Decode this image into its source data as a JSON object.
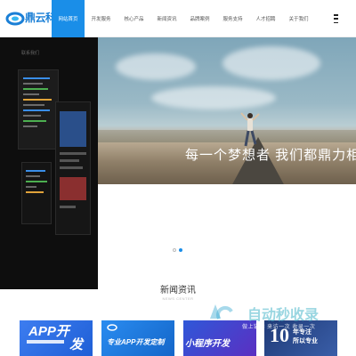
{
  "header": {
    "logo_text": "鼎云科技",
    "nav": [
      {
        "label": "网站首页",
        "active": true
      },
      {
        "label": "开发服务",
        "active": false
      },
      {
        "label": "核心产品",
        "active": false
      },
      {
        "label": "新闻资讯",
        "active": false
      },
      {
        "label": "品牌案例",
        "active": false
      },
      {
        "label": "服务支持",
        "active": false
      },
      {
        "label": "人才招聘",
        "active": false
      },
      {
        "label": "关于我们",
        "active": false
      }
    ],
    "menu_icon": "hamburger-menu-icon"
  },
  "dark_panel": {
    "label": "联系我们"
  },
  "hero": {
    "slogan": "每一个梦想者 我们都鼎力相"
  },
  "slider": {
    "total": 2,
    "current": 2
  },
  "news": {
    "title": "新闻资讯",
    "subtitle": "NEWS CENTER",
    "cards": [
      {
        "line1": "APP开",
        "line2": "发"
      },
      {
        "line1": "专业APP开发定制"
      },
      {
        "line1": "小程序开发"
      },
      {
        "line1": "10",
        "line2": "年专注",
        "line3": "所以专业"
      }
    ]
  },
  "watermark": {
    "text": "自动秒收录",
    "tagline": "做上链接 来访一次 收录一次"
  },
  "colors": {
    "accent": "#1a8ee8",
    "dark_panel": "#0e0e0e"
  }
}
